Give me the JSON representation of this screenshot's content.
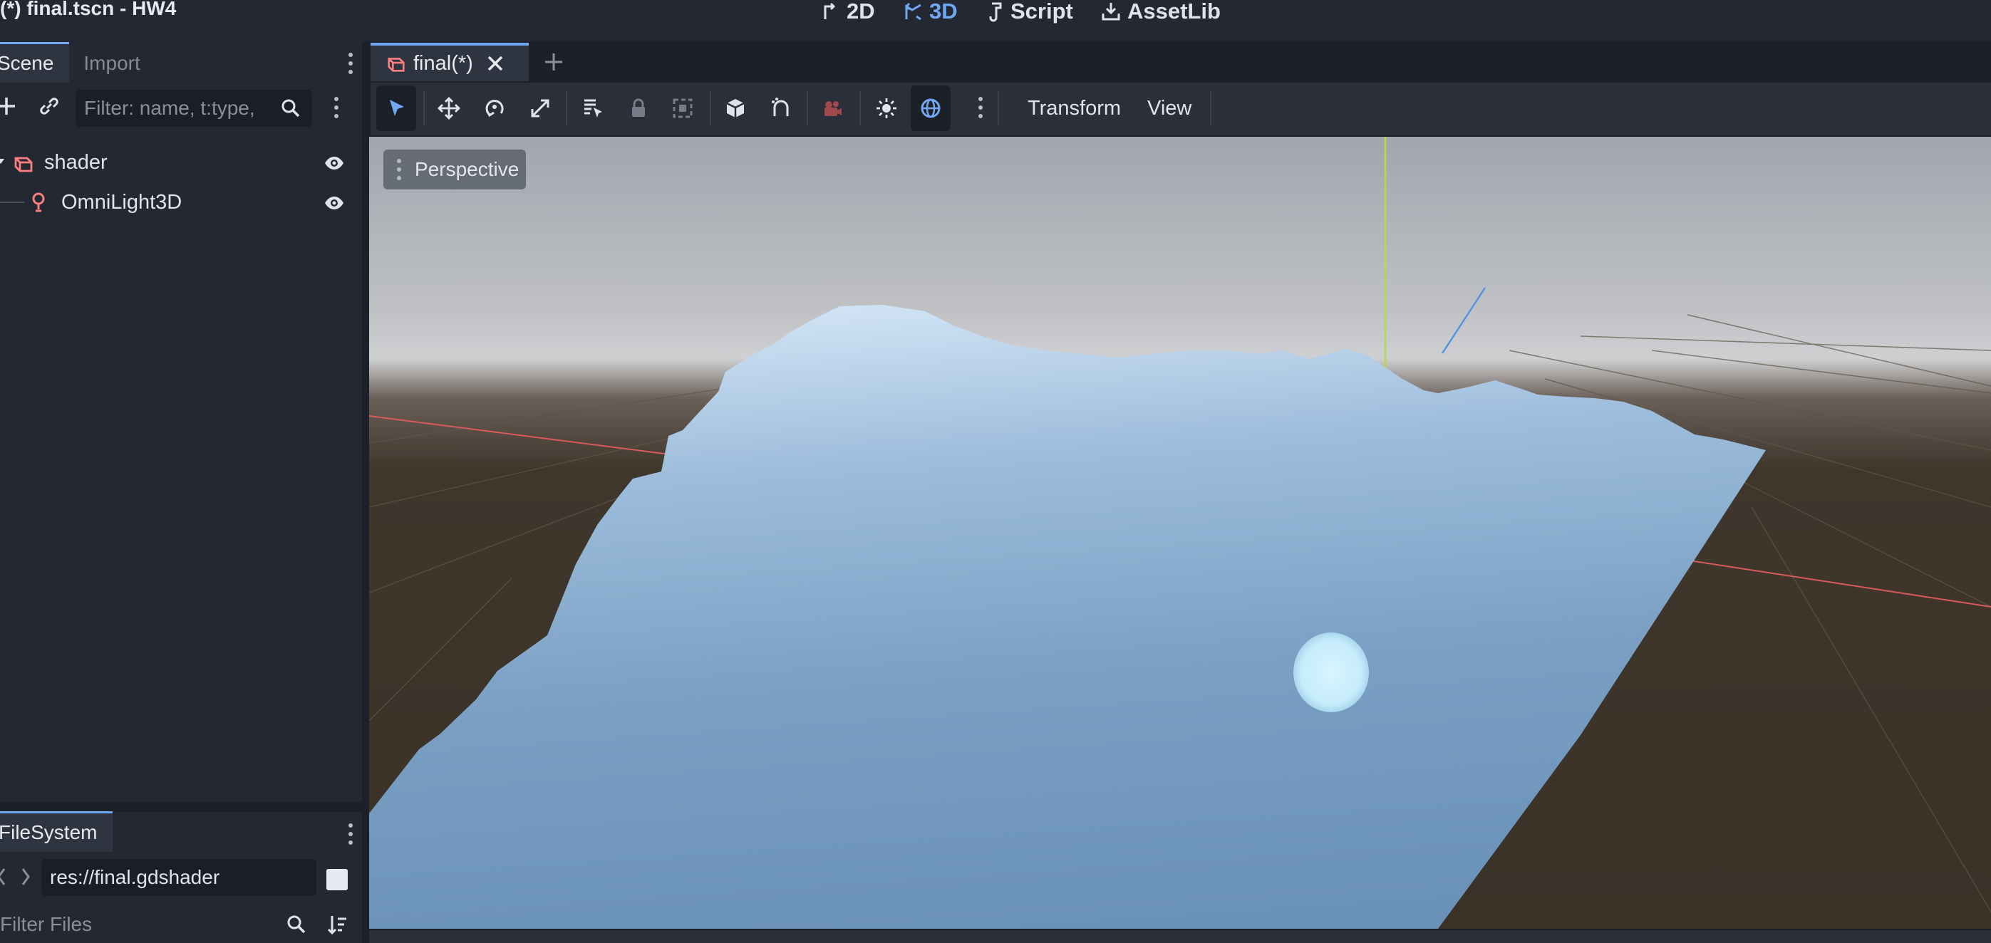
{
  "window": {
    "title": "(*) final.tscn - HW4"
  },
  "workspaces": [
    {
      "label": "2D",
      "icon": "2d-icon",
      "active": false
    },
    {
      "label": "3D",
      "icon": "3d-icon",
      "active": true
    },
    {
      "label": "Script",
      "icon": "script-icon",
      "active": false
    },
    {
      "label": "AssetLib",
      "icon": "assetlib-icon",
      "active": false
    }
  ],
  "scene_dock": {
    "tabs": [
      {
        "label": "Scene",
        "active": true
      },
      {
        "label": "Import",
        "active": false
      }
    ],
    "filter_placeholder": "Filter: name, t:type,",
    "nodes": [
      {
        "name": "shader",
        "icon": "node3d-icon",
        "icon_color": "#fc7f7f"
      },
      {
        "name": "OmniLight3D",
        "icon": "omnilight-icon",
        "icon_color": "#fc7f7f"
      }
    ]
  },
  "filesystem_dock": {
    "tab_label": "FileSystem",
    "path": "res://final.gdshader",
    "filter_placeholder": "Filter Files"
  },
  "editor": {
    "scene_tab_label": "final(*)",
    "toolbar_menus": {
      "transform": "Transform",
      "view": "View"
    },
    "viewport_label": "Perspective"
  },
  "colors": {
    "accent": "#70a6f0",
    "node_icon": "#fc7f7f",
    "sky_top": "#a4a8af",
    "ground": "#3c3328",
    "water": "#7aa2c8"
  }
}
